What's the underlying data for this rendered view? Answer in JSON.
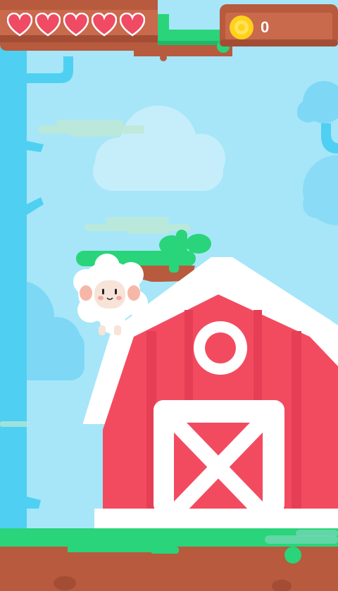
{
  "game": {
    "hud": {
      "hearts": {
        "max": 5,
        "current": 5,
        "color": "#f04a64"
      },
      "coins": {
        "count": "0",
        "coin_color": "#ffd21a"
      }
    },
    "colors": {
      "sky": "#a6e6f8",
      "tree": "#4fd0f2",
      "platform_grass": "#2ad47a",
      "platform_dirt": "#b85a3e",
      "barn_red": "#f24b60",
      "barn_trim": "#ffffff",
      "hud_panel": "#b85a3e"
    },
    "character": {
      "name": "sheep",
      "state": "idle"
    }
  }
}
